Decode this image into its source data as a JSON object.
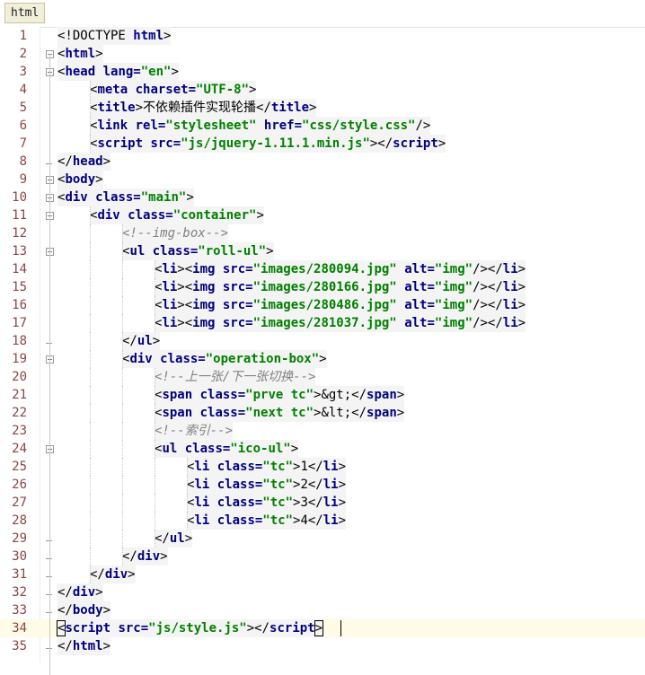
{
  "tab": {
    "label": "html"
  },
  "lines": [
    {
      "n": "1",
      "indent": 0,
      "html": "<span class=\"plain\">&lt;!DOCTYPE </span><span class=\"kw\">html</span><span class=\"plain\">&gt;</span>"
    },
    {
      "n": "2",
      "indent": 0,
      "html": "<span class=\"plain\">&lt;</span><span class=\"kw\">html</span><span class=\"plain\">&gt;</span>"
    },
    {
      "n": "3",
      "indent": 0,
      "html": "<span class=\"plain\">&lt;</span><span class=\"kw\">head lang=</span><span class=\"str\">\"en\"</span><span class=\"plain\">&gt;</span>"
    },
    {
      "n": "4",
      "indent": 1,
      "html": "<span class=\"plain\">&lt;</span><span class=\"kw\">meta charset=</span><span class=\"str\">\"UTF-8\"</span><span class=\"plain\">&gt;</span>"
    },
    {
      "n": "5",
      "indent": 1,
      "html": "<span class=\"plain\">&lt;</span><span class=\"kw\">title</span><span class=\"plain\">&gt;不依赖插件实现轮播&lt;/</span><span class=\"kw\">title</span><span class=\"plain\">&gt;</span>"
    },
    {
      "n": "6",
      "indent": 1,
      "html": "<span class=\"plain\">&lt;</span><span class=\"kw\">link rel=</span><span class=\"str\">\"stylesheet\"</span> <span class=\"kw\">href=</span><span class=\"str\">\"css/style.css\"</span><span class=\"plain\">/&gt;</span>"
    },
    {
      "n": "7",
      "indent": 1,
      "html": "<span class=\"plain\">&lt;</span><span class=\"kw\">script src=</span><span class=\"str\">\"js/jquery-1.11.1.min.js\"</span><span class=\"plain\">&gt;&lt;/</span><span class=\"kw\">script</span><span class=\"plain\">&gt;</span>"
    },
    {
      "n": "8",
      "indent": 0,
      "html": "<span class=\"plain\">&lt;/</span><span class=\"kw\">head</span><span class=\"plain\">&gt;</span>"
    },
    {
      "n": "9",
      "indent": 0,
      "html": "<span class=\"plain\">&lt;</span><span class=\"kw\">body</span><span class=\"plain\">&gt;</span>"
    },
    {
      "n": "10",
      "indent": 0,
      "html": "<span class=\"plain\">&lt;</span><span class=\"kw\">div class=</span><span class=\"str\">\"main\"</span><span class=\"plain\">&gt;</span>"
    },
    {
      "n": "11",
      "indent": 1,
      "html": "<span class=\"plain\">&lt;</span><span class=\"kw\">div class=</span><span class=\"str\">\"container\"</span><span class=\"plain\">&gt;</span>"
    },
    {
      "n": "12",
      "indent": 2,
      "html": "<span class=\"cm\">&lt;!--img-box--&gt;</span>"
    },
    {
      "n": "13",
      "indent": 2,
      "html": "<span class=\"plain\">&lt;</span><span class=\"kw\">ul class=</span><span class=\"str\">\"roll-ul\"</span><span class=\"plain\">&gt;</span>"
    },
    {
      "n": "14",
      "indent": 3,
      "html": "<span class=\"plain\">&lt;</span><span class=\"kw\">li</span><span class=\"plain\">&gt;&lt;</span><span class=\"kw\">img src=</span><span class=\"str\">\"images/280094.jpg\"</span> <span class=\"kw\">alt=</span><span class=\"str\">\"img\"</span><span class=\"plain\">/&gt;&lt;/</span><span class=\"kw\">li</span><span class=\"plain\">&gt;</span>"
    },
    {
      "n": "15",
      "indent": 3,
      "html": "<span class=\"plain\">&lt;</span><span class=\"kw\">li</span><span class=\"plain\">&gt;&lt;</span><span class=\"kw\">img src=</span><span class=\"str\">\"images/280166.jpg\"</span> <span class=\"kw\">alt=</span><span class=\"str\">\"img\"</span><span class=\"plain\">/&gt;&lt;/</span><span class=\"kw\">li</span><span class=\"plain\">&gt;</span>"
    },
    {
      "n": "16",
      "indent": 3,
      "html": "<span class=\"plain\">&lt;</span><span class=\"kw\">li</span><span class=\"plain\">&gt;&lt;</span><span class=\"kw\">img src=</span><span class=\"str\">\"images/280486.jpg\"</span> <span class=\"kw\">alt=</span><span class=\"str\">\"img\"</span><span class=\"plain\">/&gt;&lt;/</span><span class=\"kw\">li</span><span class=\"plain\">&gt;</span>"
    },
    {
      "n": "17",
      "indent": 3,
      "html": "<span class=\"plain\">&lt;</span><span class=\"kw\">li</span><span class=\"plain\">&gt;&lt;</span><span class=\"kw\">img src=</span><span class=\"str\">\"images/281037.jpg\"</span> <span class=\"kw\">alt=</span><span class=\"str\">\"img\"</span><span class=\"plain\">/&gt;&lt;/</span><span class=\"kw\">li</span><span class=\"plain\">&gt;</span>"
    },
    {
      "n": "18",
      "indent": 2,
      "html": "<span class=\"plain\">&lt;/</span><span class=\"kw\">ul</span><span class=\"plain\">&gt;</span>"
    },
    {
      "n": "19",
      "indent": 2,
      "html": "<span class=\"plain\">&lt;</span><span class=\"kw\">div class=</span><span class=\"str\">\"operation-box\"</span><span class=\"plain\">&gt;</span>"
    },
    {
      "n": "20",
      "indent": 3,
      "html": "<span class=\"cm\">&lt;!--上一张/下一张切换--&gt;</span>"
    },
    {
      "n": "21",
      "indent": 3,
      "html": "<span class=\"plain\">&lt;</span><span class=\"kw\">span class=</span><span class=\"str\">\"prve tc\"</span><span class=\"plain\">&gt;&amp;gt;&lt;/</span><span class=\"kw\">span</span><span class=\"plain\">&gt;</span>"
    },
    {
      "n": "22",
      "indent": 3,
      "html": "<span class=\"plain\">&lt;</span><span class=\"kw\">span class=</span><span class=\"str\">\"next tc\"</span><span class=\"plain\">&gt;&amp;lt;&lt;/</span><span class=\"kw\">span</span><span class=\"plain\">&gt;</span>"
    },
    {
      "n": "23",
      "indent": 3,
      "html": "<span class=\"cm\">&lt;!--索引--&gt;</span>"
    },
    {
      "n": "24",
      "indent": 3,
      "html": "<span class=\"plain\">&lt;</span><span class=\"kw\">ul class=</span><span class=\"str\">\"ico-ul\"</span><span class=\"plain\">&gt;</span>"
    },
    {
      "n": "25",
      "indent": 4,
      "html": "<span class=\"plain\">&lt;</span><span class=\"kw\">li class=</span><span class=\"str\">\"tc\"</span><span class=\"plain\">&gt;1&lt;/</span><span class=\"kw\">li</span><span class=\"plain\">&gt;</span>"
    },
    {
      "n": "26",
      "indent": 4,
      "html": "<span class=\"plain\">&lt;</span><span class=\"kw\">li class=</span><span class=\"str\">\"tc\"</span><span class=\"plain\">&gt;2&lt;/</span><span class=\"kw\">li</span><span class=\"plain\">&gt;</span>"
    },
    {
      "n": "27",
      "indent": 4,
      "html": "<span class=\"plain\">&lt;</span><span class=\"kw\">li class=</span><span class=\"str\">\"tc\"</span><span class=\"plain\">&gt;3&lt;/</span><span class=\"kw\">li</span><span class=\"plain\">&gt;</span>"
    },
    {
      "n": "28",
      "indent": 4,
      "html": "<span class=\"plain\">&lt;</span><span class=\"kw\">li class=</span><span class=\"str\">\"tc\"</span><span class=\"plain\">&gt;4&lt;/</span><span class=\"kw\">li</span><span class=\"plain\">&gt;</span>"
    },
    {
      "n": "29",
      "indent": 3,
      "html": "<span class=\"plain\">&lt;/</span><span class=\"kw\">ul</span><span class=\"plain\">&gt;</span>"
    },
    {
      "n": "30",
      "indent": 2,
      "html": "<span class=\"plain\">&lt;/</span><span class=\"kw\">div</span><span class=\"plain\">&gt;</span>"
    },
    {
      "n": "31",
      "indent": 1,
      "html": "<span class=\"plain\">&lt;/</span><span class=\"kw\">div</span><span class=\"plain\">&gt;</span>"
    },
    {
      "n": "32",
      "indent": 0,
      "html": "<span class=\"plain\">&lt;/</span><span class=\"kw\">div</span><span class=\"plain\">&gt;</span>"
    },
    {
      "n": "33",
      "indent": 0,
      "html": "<span class=\"plain\">&lt;/</span><span class=\"kw\">body</span><span class=\"plain\">&gt;</span>"
    },
    {
      "n": "34",
      "indent": 0,
      "html": "<span class=\"plain caret-box\">&lt;</span><span class=\"kw\">script src=</span><span class=\"str\">\"js/style.js\"</span><span class=\"plain\">&gt;&lt;/</span><span class=\"kw\">script</span><span class=\"plain caret-box\">&gt;</span>"
    },
    {
      "n": "35",
      "indent": 0,
      "html": "<span class=\"plain\">&lt;/</span><span class=\"kw\">html</span><span class=\"plain\">&gt;</span>"
    }
  ]
}
